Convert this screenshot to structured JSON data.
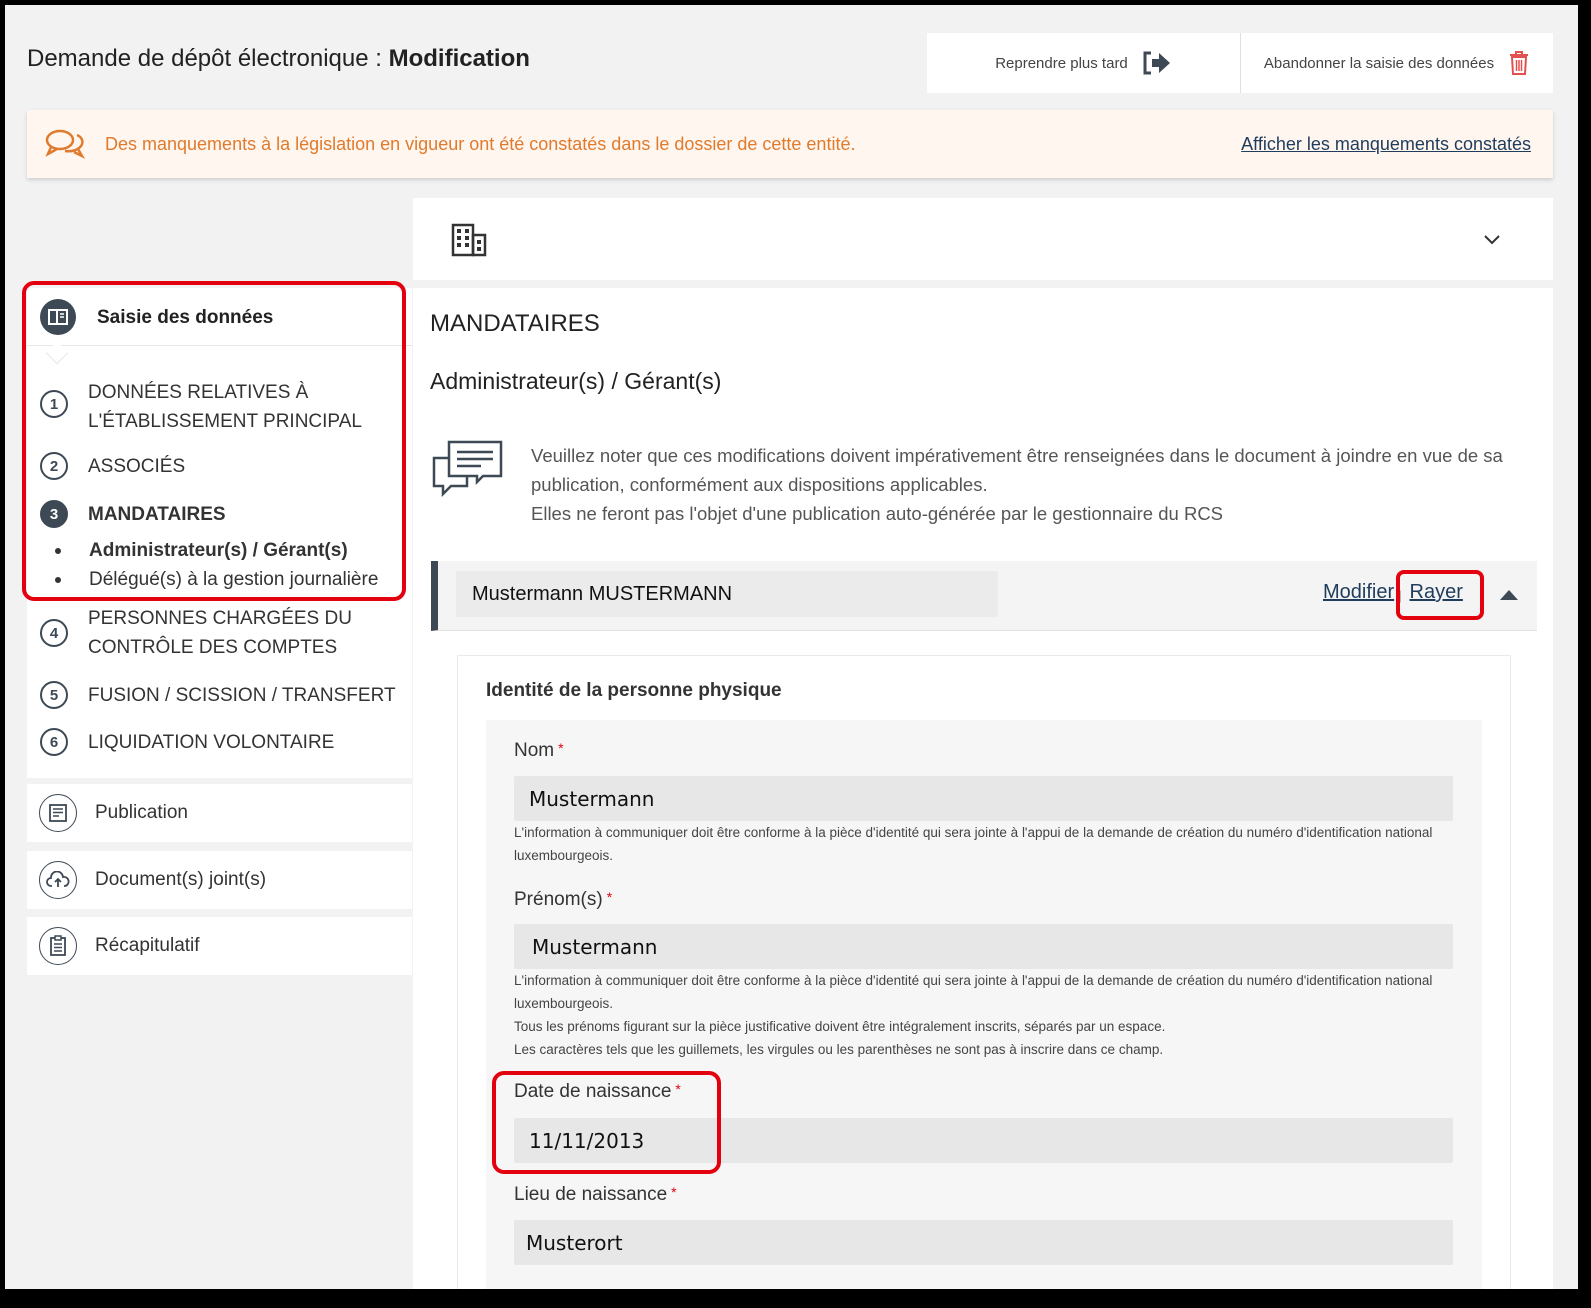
{
  "header": {
    "title_prefix": "Demande de dépôt électronique :",
    "title_strong": "Modification",
    "resume_later": "Reprendre plus tard",
    "abandon": "Abandonner la saisie des données"
  },
  "alert": {
    "text": "Des manquements à la législation en vigueur ont été constatés dans le dossier de cette entité.",
    "link": "Afficher les manquements constatés"
  },
  "sidebar": {
    "head": "Saisie des données",
    "steps": [
      {
        "num": "1",
        "label": "DONNÉES RELATIVES À L'ÉTABLISSEMENT PRINCIPAL"
      },
      {
        "num": "2",
        "label": "ASSOCIÉS"
      },
      {
        "num": "3",
        "label": "MANDATAIRES"
      },
      {
        "num": "4",
        "label": "PERSONNES CHARGÉES DU CONTRÔLE DES COMPTES"
      },
      {
        "num": "5",
        "label": "FUSION / SCISSION / TRANSFERT"
      },
      {
        "num": "6",
        "label": "LIQUIDATION VOLONTAIRE"
      }
    ],
    "substeps": [
      "Administrateur(s) / Gérant(s)",
      "Délégué(s) à la gestion journalière"
    ],
    "cards": [
      "Publication",
      "Document(s) joint(s)",
      "Récapitulatif"
    ]
  },
  "main": {
    "section_title": "MANDATAIRES",
    "subsection_title": "Administrateur(s) / Gérant(s)",
    "note_lines": [
      "Veuillez noter que ces modifications doivent impérativement être renseignées dans le document à joindre en vue de sa publication, conformément aux dispositions applicables.",
      "Elles ne feront pas l'objet d'une publication auto-générée par le gestionnaire du RCS"
    ],
    "person": {
      "name": "Mustermann MUSTERMANN",
      "modify": "Modifier",
      "separator": "|",
      "strike": "Rayer"
    },
    "identity_title": "Identité de la personne physique",
    "fields": {
      "nom": {
        "label": "Nom",
        "value": "Mustermann",
        "helper": "L'information à communiquer doit être conforme à la pièce d'identité qui sera jointe à l'appui de la demande de création du numéro d'identification national luxembourgeois."
      },
      "prenom": {
        "label": "Prénom(s)",
        "value": "Mustermann",
        "helper_lines": [
          "L'information à communiquer doit être conforme à la pièce d'identité qui sera jointe à l'appui de la demande de création du numéro d'identification national luxembourgeois.",
          "Tous les prénoms figurant sur la pièce justificative doivent être intégralement inscrits, séparés par un espace.",
          "Les caractères tels que les guillemets, les virgules ou les parenthèses ne sont pas à inscrire dans ce champ."
        ]
      },
      "date_naissance": {
        "label": "Date de naissance",
        "value": "11/11/2013"
      },
      "lieu_naissance": {
        "label": "Lieu de naissance",
        "value": "Musterort"
      }
    },
    "required_mark": "*"
  },
  "colors": {
    "accent_dark": "#3d4955",
    "alert_text": "#e07a2c",
    "link": "#1f3c5c",
    "highlight_red": "#e3000f",
    "required": "#e3000f"
  },
  "icons": [
    "exit-icon",
    "trash-icon",
    "chat-bubbles-icon",
    "building-icon",
    "chevron-down-icon",
    "layout-icon",
    "publication-icon",
    "cloud-upload-icon",
    "clipboard-icon",
    "message-icon",
    "caret-up-icon"
  ]
}
